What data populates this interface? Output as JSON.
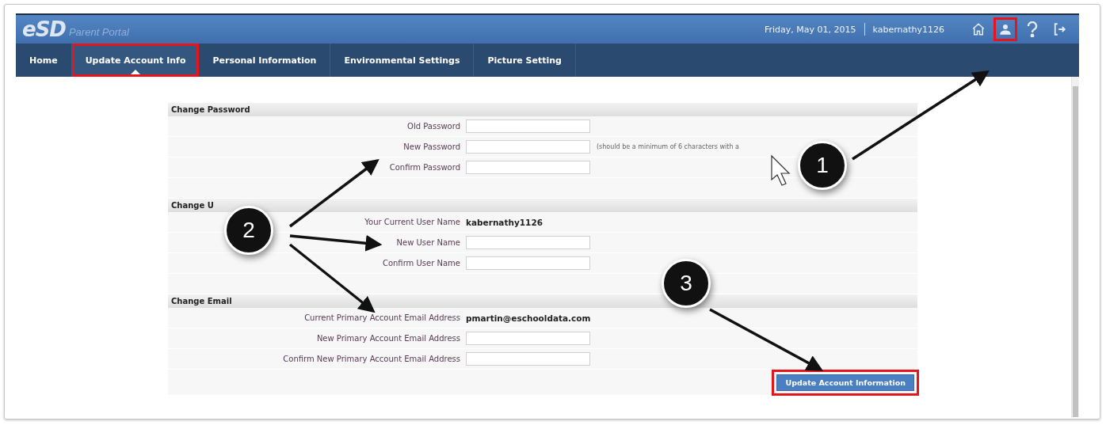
{
  "header": {
    "logo": "eSD",
    "subtitle": "Parent Portal",
    "date": "Friday, May 01, 2015",
    "user": "kabernathy1126",
    "icons": [
      {
        "kind": "home",
        "highlighted": false
      },
      {
        "kind": "user",
        "highlighted": true
      },
      {
        "kind": "help",
        "highlighted": false
      },
      {
        "kind": "logout",
        "highlighted": false
      }
    ]
  },
  "nav": [
    {
      "label": "Home",
      "selected": false,
      "highlighted": false
    },
    {
      "label": "Update Account Info",
      "selected": true,
      "highlighted": true
    },
    {
      "label": "Personal Information",
      "selected": false,
      "highlighted": false
    },
    {
      "label": "Environmental Settings",
      "selected": false,
      "highlighted": false
    },
    {
      "label": "Picture Setting",
      "selected": false,
      "highlighted": false
    }
  ],
  "sections": [
    {
      "title": "Change Password",
      "rows": [
        {
          "kind": "input",
          "label": "Old Password"
        },
        {
          "kind": "input",
          "label": "New Password",
          "hint": "(should be a minimum of 6 characters with a"
        },
        {
          "kind": "input",
          "label": "Confirm Password"
        }
      ]
    },
    {
      "title": "Change U",
      "rows": [
        {
          "kind": "value",
          "label": "Your Current User Name",
          "value": "kabernathy1126"
        },
        {
          "kind": "input",
          "label": "New User Name"
        },
        {
          "kind": "input",
          "label": "Confirm User Name"
        }
      ]
    },
    {
      "title": "Change Email",
      "rows": [
        {
          "kind": "value",
          "label": "Current Primary Account Email Address",
          "value": "pmartin@eschooldata.com"
        },
        {
          "kind": "input",
          "label": "New Primary Account Email Address"
        },
        {
          "kind": "input",
          "label": "Confirm New Primary Account Email Address"
        }
      ]
    }
  ],
  "submit": {
    "label": "Update Account Information",
    "highlighted": true
  },
  "callouts": [
    {
      "number": "1"
    },
    {
      "number": "2"
    },
    {
      "number": "3"
    }
  ]
}
